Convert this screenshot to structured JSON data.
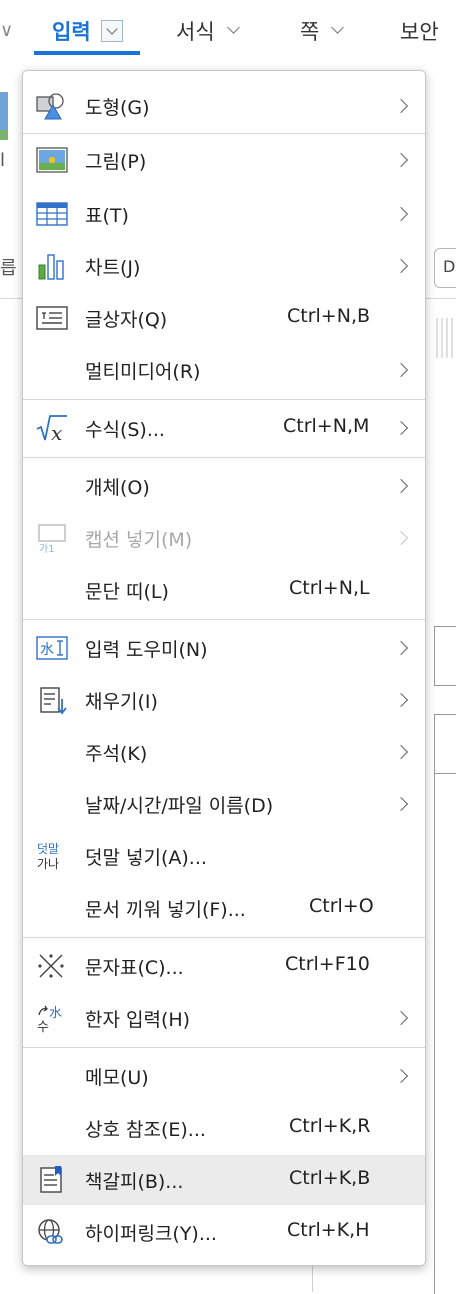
{
  "menubar": {
    "tabs": [
      {
        "label": "입력"
      },
      {
        "label": "서식"
      },
      {
        "label": "쪽"
      },
      {
        "label": "보안"
      }
    ],
    "accent": "#1a73d6"
  },
  "background": {
    "combo_text": "D",
    "left_glyph": "릅",
    "left_glyph2": "l"
  },
  "menu": {
    "items": [
      {
        "label": "도형(G)",
        "shortcut": "",
        "submenu": true,
        "icon": "shape-icon"
      },
      {
        "label": "그림(P)",
        "shortcut": "",
        "submenu": true,
        "icon": "picture-icon"
      },
      {
        "label": "표(T)",
        "shortcut": "",
        "submenu": true,
        "icon": "table-icon"
      },
      {
        "label": "차트(J)",
        "shortcut": "",
        "submenu": true,
        "icon": "chart-icon"
      },
      {
        "label": "글상자(Q)",
        "shortcut": "Ctrl+N,B",
        "submenu": false,
        "icon": "textbox-icon"
      },
      {
        "label": "멀티미디어(R)",
        "shortcut": "",
        "submenu": true,
        "icon": ""
      },
      {
        "label": "수식(S)...",
        "shortcut": "Ctrl+N,M",
        "submenu": true,
        "icon": "formula-icon"
      },
      {
        "label": "개체(O)",
        "shortcut": "",
        "submenu": true,
        "icon": ""
      },
      {
        "label": "캡션 넣기(M)",
        "shortcut": "",
        "submenu": true,
        "icon": "caption-icon",
        "disabled": true
      },
      {
        "label": "문단 띠(L)",
        "shortcut": "Ctrl+N,L",
        "submenu": false,
        "icon": ""
      },
      {
        "label": "입력 도우미(N)",
        "shortcut": "",
        "submenu": true,
        "icon": "input-helper-icon"
      },
      {
        "label": "채우기(I)",
        "shortcut": "",
        "submenu": true,
        "icon": "fill-icon"
      },
      {
        "label": "주석(K)",
        "shortcut": "",
        "submenu": true,
        "icon": ""
      },
      {
        "label": "날짜/시간/파일 이름(D)",
        "shortcut": "",
        "submenu": true,
        "icon": ""
      },
      {
        "label": "덧말 넣기(A)...",
        "shortcut": "",
        "submenu": false,
        "icon": "ruby-text-icon",
        "icon_text_top": "덧말",
        "icon_text_bottom": "가나"
      },
      {
        "label": "문서 끼워 넣기(F)...",
        "shortcut": "Ctrl+O",
        "submenu": false,
        "icon": ""
      },
      {
        "label": "문자표(C)...",
        "shortcut": "Ctrl+F10",
        "submenu": false,
        "icon": "symbol-icon"
      },
      {
        "label": "한자 입력(H)",
        "shortcut": "",
        "submenu": true,
        "icon": "hanja-icon",
        "icon_text_top": "水",
        "icon_text_bottom": "수"
      },
      {
        "label": "메모(U)",
        "shortcut": "",
        "submenu": true,
        "icon": ""
      },
      {
        "label": "상호 참조(E)...",
        "shortcut": "Ctrl+K,R",
        "submenu": false,
        "icon": ""
      },
      {
        "label": "책갈피(B)...",
        "shortcut": "Ctrl+K,B",
        "submenu": false,
        "icon": "bookmark-icon",
        "hovered": true
      },
      {
        "label": "하이퍼링크(Y)...",
        "shortcut": "Ctrl+K,H",
        "submenu": false,
        "icon": "hyperlink-icon"
      }
    ]
  }
}
